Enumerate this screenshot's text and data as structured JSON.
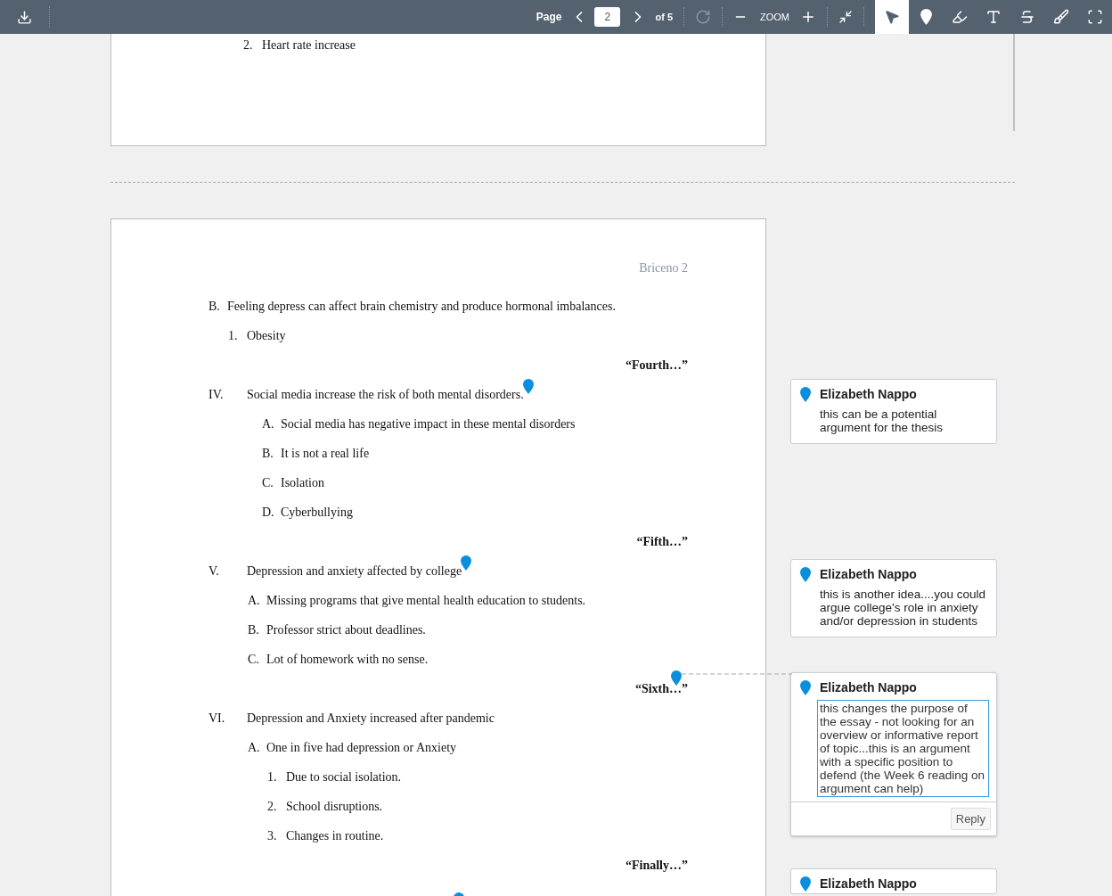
{
  "toolbar": {
    "page_label": "Page",
    "page_value": "2",
    "page_total": "of 5",
    "zoom_label": "ZOOM",
    "rotate_disabled": true,
    "tools": [
      {
        "kind": "select",
        "selected": true
      },
      {
        "kind": "pin",
        "selected": false
      },
      {
        "kind": "highlight",
        "selected": false
      },
      {
        "kind": "text",
        "selected": false
      },
      {
        "kind": "strike",
        "selected": false
      },
      {
        "kind": "draw",
        "selected": false
      },
      {
        "kind": "area",
        "selected": false
      }
    ]
  },
  "previous_page": {
    "marker": "2.",
    "text": "Heart rate increase"
  },
  "page": {
    "running_head": "Briceno 2",
    "lines": [
      {
        "kind": "item",
        "marker": "B.",
        "text": "Feeling depress can affect brain chemistry and produce hormonal imbalances.",
        "children": [
          {
            "marker": "1.",
            "text": "Obesity"
          }
        ]
      },
      {
        "kind": "heading",
        "text": "“Fourth…”"
      },
      {
        "kind": "item",
        "marker": "IV.",
        "text": "Social media increase the risk of both mental disorders.",
        "pinned": true,
        "children": [
          {
            "marker": "A.",
            "text": "Social media has negative impact in these mental disorders"
          },
          {
            "marker": "B.",
            "text": "It is not a real life"
          },
          {
            "marker": "C.",
            "text": "Isolation"
          },
          {
            "marker": "D.",
            "text": "Cyberbullying"
          }
        ]
      },
      {
        "kind": "heading",
        "text": "“Fifth…”"
      },
      {
        "kind": "item",
        "marker": "V.",
        "text": "Depression and anxiety affected by college",
        "pinned": true,
        "children": [
          {
            "marker": "A.",
            "text": "Missing programs that give mental health education to students."
          },
          {
            "marker": "B.",
            "text": "Professor strict about deadlines."
          },
          {
            "marker": "C.",
            "text": "Lot of homework with no sense."
          }
        ]
      },
      {
        "kind": "heading",
        "text": "“Sixth…”",
        "pinned": true,
        "linked": true
      },
      {
        "kind": "item",
        "marker": "VI.",
        "text": "Depression and Anxiety increased after pandemic",
        "children": [
          {
            "marker": "A.",
            "text": "One in five had depression or Anxiety",
            "children": [
              {
                "marker": "1.",
                "text": "Due to social isolation."
              },
              {
                "marker": "2.",
                "text": "School disruptions."
              },
              {
                "marker": "3.",
                "text": "Changes in routine."
              }
            ]
          }
        ]
      },
      {
        "kind": "heading",
        "text": "“Finally…”"
      },
      {
        "kind": "pin"
      }
    ]
  },
  "comments": [
    {
      "author": "Elizabeth Nappo",
      "text": "this can be a potential argument for the thesis",
      "selected": false
    },
    {
      "author": "Elizabeth Nappo",
      "text": "this is another idea....you could argue college's role in anxiety and/or depression in students",
      "selected": false
    },
    {
      "author": "Elizabeth Nappo",
      "text": "this changes the purpose of the essay - not looking for an overview or informative report of topic...this is an argument with a specific position to defend (the Week 6 reading on argument can help)",
      "selected": true,
      "reply_label": "Reply"
    },
    {
      "author": "Elizabeth Nappo",
      "selected": false
    }
  ]
}
